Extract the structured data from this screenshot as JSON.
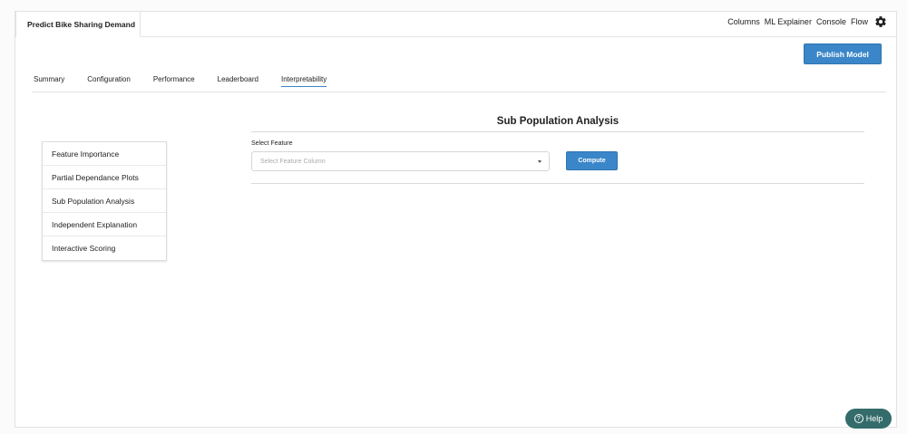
{
  "project": {
    "title": "Predict Bike Sharing Demand"
  },
  "top_nav": {
    "columns": "Columns",
    "ml_explainer": "ML Explainer",
    "console": "Console",
    "flow": "Flow",
    "settings_icon": "gear-icon"
  },
  "publish_button": "Publish Model",
  "tabs": [
    {
      "label": "Summary"
    },
    {
      "label": "Configuration"
    },
    {
      "label": "Performance"
    },
    {
      "label": "Leaderboard"
    },
    {
      "label": "Interpretability",
      "active": true
    }
  ],
  "side_menu": [
    {
      "label": "Feature Importance"
    },
    {
      "label": "Partial Dependance Plots"
    },
    {
      "label": "Sub Population Analysis"
    },
    {
      "label": "Independent Explanation"
    },
    {
      "label": "Interactive Scoring"
    }
  ],
  "main": {
    "title": "Sub Population Analysis",
    "select_label": "Select Feature",
    "select_placeholder": "Select Feature Column",
    "compute_button": "Compute"
  },
  "help": {
    "label": "Help",
    "icon": "question-circle-icon"
  },
  "colors": {
    "accent": "#3a86c8",
    "help_bg": "#346b6b"
  }
}
